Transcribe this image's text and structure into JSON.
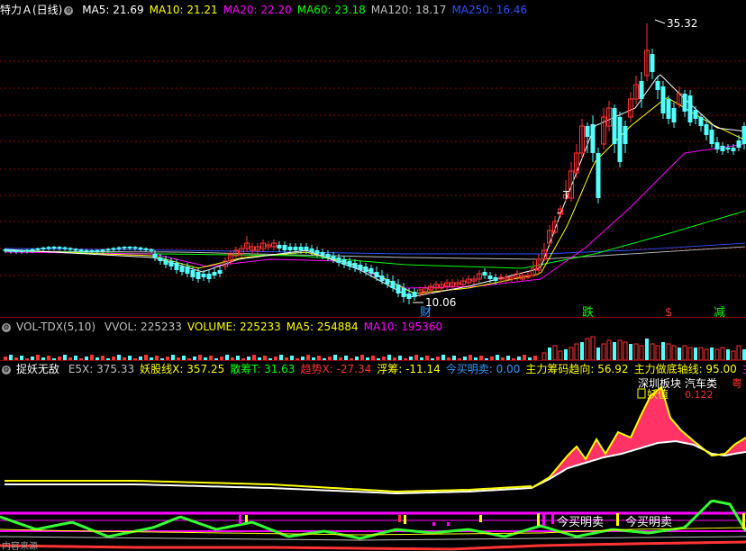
{
  "main": {
    "title": "特力Ａ(日线)",
    "ma": [
      {
        "label": "MA5: 21.69",
        "color": "#ffffff"
      },
      {
        "label": "MA10: 21.21",
        "color": "#ffff00"
      },
      {
        "label": "MA20: 22.20",
        "color": "#ff00ff"
      },
      {
        "label": "MA60: 23.18",
        "color": "#00ff00"
      },
      {
        "label": "MA120: 18.17",
        "color": "#c0c0c0"
      },
      {
        "label": "MA250: 16.46",
        "color": "#3050ff"
      }
    ],
    "high_label": "35.32",
    "low_label": "10.06",
    "markers": [
      {
        "text": "财",
        "color": "#3399ff"
      },
      {
        "text": "跌",
        "color": "#00ff00"
      },
      {
        "text": "$",
        "color": "#ff3030"
      },
      {
        "text": "减",
        "color": "#00ff00"
      }
    ]
  },
  "volume": {
    "title": "VOL-TDX(5,10)",
    "items": [
      {
        "label": "VVOL: 225233",
        "color": "#c0c0c0"
      },
      {
        "label": "VOLUME: 225233",
        "color": "#ffff00"
      },
      {
        "label": "MA5: 254884",
        "color": "#ffff00"
      },
      {
        "label": "MA10: 195360",
        "color": "#ff00ff"
      }
    ]
  },
  "indicator": {
    "title": "捉妖无敌",
    "items": [
      {
        "label": "E5X: 375.33",
        "color": "#c0c0c0"
      },
      {
        "label": "妖股线X: 357.25",
        "color": "#ffff00"
      },
      {
        "label": "散筹T: 31.63",
        "color": "#00ff00"
      },
      {
        "label": "趋势X: -27.34",
        "color": "#ff3030"
      },
      {
        "label": "浮筹: -11.14",
        "color": "#ffff00"
      },
      {
        "label": "今买明卖: 0.00",
        "color": "#3399ff"
      },
      {
        "label": "主力筹码趋向: 56.92",
        "color": "#ffff00"
      },
      {
        "label": "主力做底轴线: 95.00",
        "color": "#ffff00"
      },
      {
        "label": "主力做大底",
        "color": "#ff00ff"
      }
    ],
    "labels": [
      {
        "text": "深圳板块",
        "color": "#ffffff"
      },
      {
        "text": "汽车类",
        "color": "#ffffff"
      },
      {
        "text": "粤",
        "color": "#ff3030"
      },
      {
        "text": "妖值",
        "color": "#ffff00"
      },
      {
        "text": "0.122",
        "color": "#ff3030"
      },
      {
        "text": "今买明卖",
        "color": "#ffffff"
      },
      {
        "text": "今买明卖",
        "color": "#ffffff"
      },
      {
        "text": "内容来源",
        "color": "#9a9a9a"
      }
    ]
  }
}
